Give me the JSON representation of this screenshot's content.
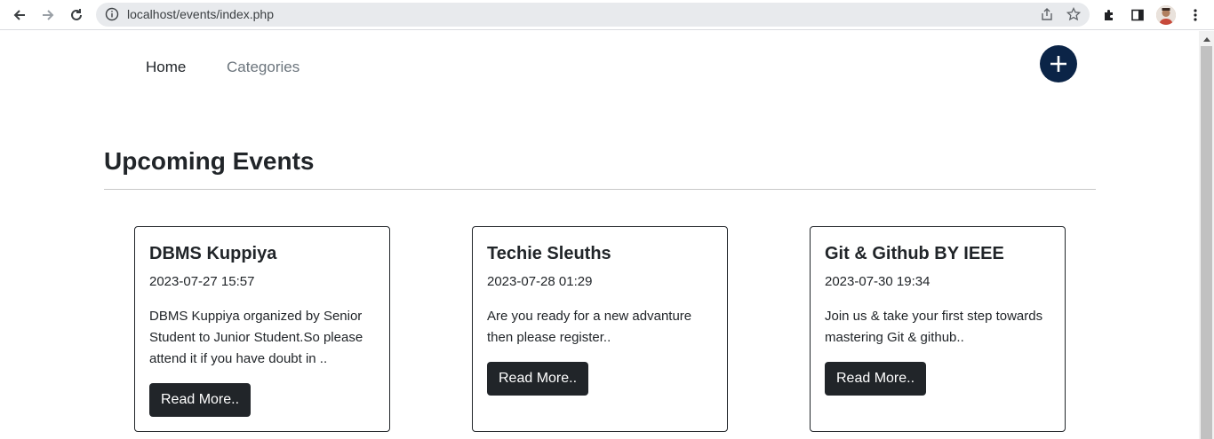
{
  "browser": {
    "url": "localhost/events/index.php"
  },
  "navbar": {
    "links": [
      {
        "label": "Home"
      },
      {
        "label": "Categories"
      }
    ],
    "add_icon": "plus-icon"
  },
  "page": {
    "title": "Upcoming Events"
  },
  "events": [
    {
      "title": "DBMS Kuppiya",
      "datetime": "2023-07-27 15:57",
      "description": "DBMS Kuppiya organized by Senior Student to Junior Student.So please attend it if you have doubt in ..",
      "button": "Read More.."
    },
    {
      "title": "Techie Sleuths",
      "datetime": "2023-07-28 01:29",
      "description": "Are you ready for a new advanture then please register..",
      "button": "Read More.."
    },
    {
      "title": "Git & Github BY IEEE",
      "datetime": "2023-07-30 19:34",
      "description": "Join us & take your first step towards mastering Git & github..",
      "button": "Read More.."
    }
  ],
  "colors": {
    "add_button": "#0b2447",
    "button_dark": "#212529",
    "muted_link": "#6c757d"
  }
}
